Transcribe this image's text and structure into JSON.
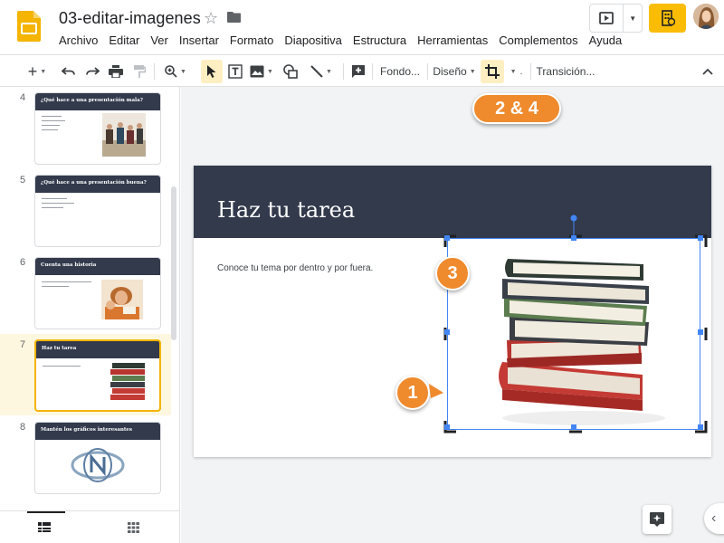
{
  "app": {
    "document_title": "03-editar-imagenes",
    "menu": [
      "Archivo",
      "Editar",
      "Ver",
      "Insertar",
      "Formato",
      "Diapositiva",
      "Estructura",
      "Herramientas",
      "Complementos",
      "Ayuda"
    ]
  },
  "toolbar": {
    "background_label": "Fondo...",
    "layout_label": "Diseño",
    "transition_label": "Transición..."
  },
  "filmstrip": {
    "slides": [
      {
        "number": "4",
        "title": "¿Qué hace a una presentación mala?"
      },
      {
        "number": "5",
        "title": "¿Qué hace a una presentación buena?"
      },
      {
        "number": "6",
        "title": "Cuenta una historia"
      },
      {
        "number": "7",
        "title": "Haz tu tarea"
      },
      {
        "number": "8",
        "title": "Mantén los gráficos interesantes"
      }
    ]
  },
  "slide": {
    "title": "Haz tu tarea",
    "body": "Conoce tu tema por dentro y por fuera."
  },
  "callouts": {
    "crop": "2 & 4",
    "image": "1",
    "handle": "3"
  },
  "colors": {
    "accent": "#fbbc04",
    "slide_header": "#323a4c",
    "selection": "#4285f4",
    "callout": "#ef8a2d"
  }
}
